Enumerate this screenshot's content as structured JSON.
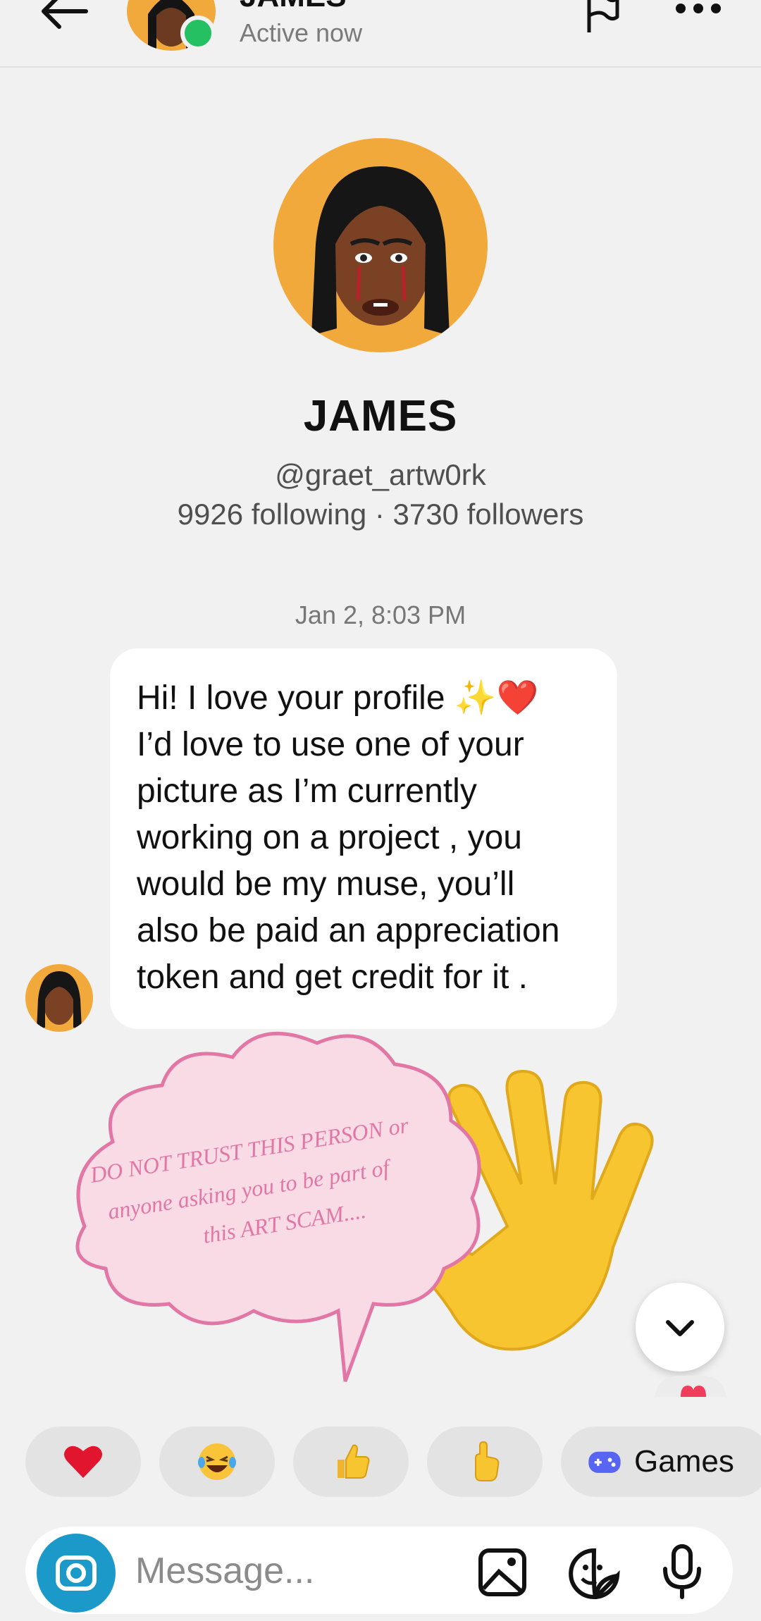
{
  "header": {
    "title": "JAMES",
    "status": "Active now"
  },
  "profile": {
    "name": "JAMES",
    "handle": "@graet_artw0rk",
    "stats": "9926 following · 3730 followers"
  },
  "conversation": {
    "timestamp": "Jan 2, 8:03 PM",
    "message_lines": [
      "Hi! I love your profile ✨❤️",
      "I’d love to use one of your",
      "picture as I’m currently",
      "working on a project , you",
      "would be my muse, you’ll",
      "also be paid an appreciation",
      "token and get credit for it ."
    ]
  },
  "warning_overlay": {
    "lines": [
      "DO NOT TRUST THIS PERSON or",
      "anyone asking you to be part of",
      "this ART SCAM...."
    ]
  },
  "quick_reactions": [
    {
      "icon": "heart-icon"
    },
    {
      "icon": "laughing-emoji-icon"
    },
    {
      "icon": "thumbs-up-icon"
    },
    {
      "icon": "pointing-hand-icon"
    },
    {
      "icon": "gamepad-icon",
      "label": "Games"
    }
  ],
  "composer": {
    "placeholder": "Message..."
  },
  "colors": {
    "background": "#f1f1f1",
    "online": "#24c062",
    "camera_button": "#1b9ac9",
    "overlay_pink": "#e277a6",
    "overlay_fill": "#f9dbe6"
  }
}
